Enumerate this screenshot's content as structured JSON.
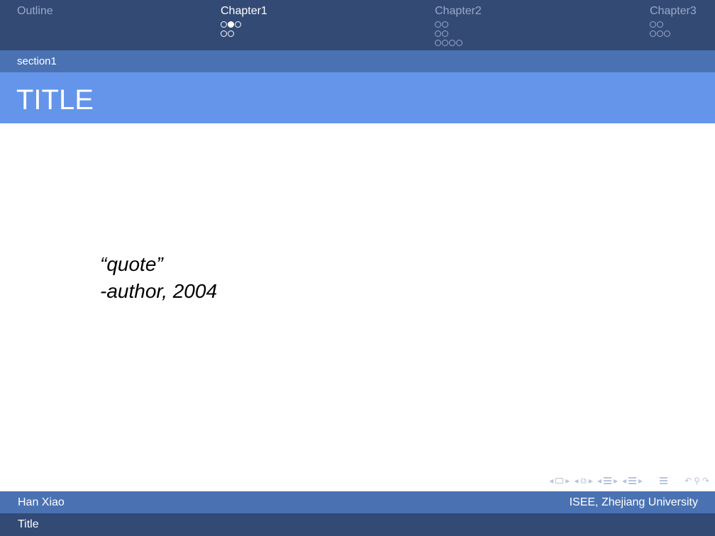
{
  "headline": {
    "sections": [
      {
        "label": "Outline",
        "active": false,
        "dots": []
      },
      {
        "label": "Chapter1",
        "active": true,
        "dots": [
          [
            0,
            1,
            0
          ],
          [
            0,
            0
          ]
        ]
      },
      {
        "label": "Chapter2",
        "active": false,
        "dots": [
          [
            0,
            0
          ],
          [
            0,
            0
          ],
          [
            0,
            0,
            0,
            0
          ]
        ]
      },
      {
        "label": "Chapter3",
        "active": false,
        "dots": [
          [
            0,
            0
          ],
          [
            0,
            0,
            0
          ]
        ]
      }
    ]
  },
  "subsection": {
    "label": "section1"
  },
  "frame": {
    "title": "TITLE"
  },
  "body": {
    "quote": "“quote”",
    "attribution": "-author, 2004"
  },
  "footer": {
    "author": "Han Xiao",
    "institute": "ISEE, Zhejiang University",
    "short_title": "Title"
  },
  "colors": {
    "headline_bg": "#334a75",
    "subsection_bg": "#4a72b3",
    "frametitle_bg": "#6495ea",
    "inactive_text": "#9aa9c6"
  }
}
